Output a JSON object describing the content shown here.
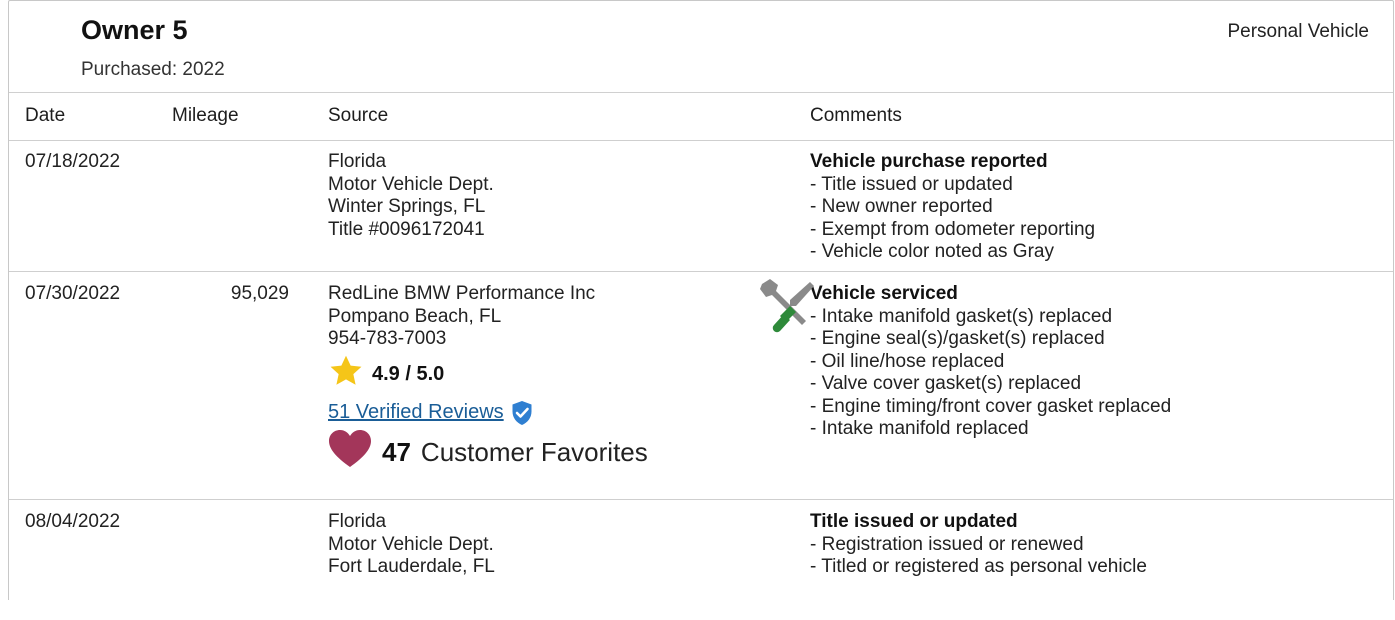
{
  "owner": {
    "title": "Owner 5",
    "purchased": "Purchased: 2022",
    "usage": "Personal Vehicle"
  },
  "table": {
    "headers": {
      "date": "Date",
      "mileage": "Mileage",
      "source": "Source",
      "comments": "Comments"
    },
    "rows": [
      {
        "date": "07/18/2022",
        "mileage": "",
        "source": [
          "Florida",
          "Motor Vehicle Dept.",
          "Winter Springs, FL",
          "Title #0096172041"
        ],
        "comment_head": "Vehicle purchase reported",
        "comments": [
          "- Title issued or updated",
          "- New owner reported",
          "- Exempt from odometer reporting",
          "- Vehicle color noted as Gray"
        ]
      },
      {
        "date": "07/30/2022",
        "mileage": "95,029",
        "source": [
          "RedLine BMW Performance Inc",
          "Pompano Beach, FL",
          "954-783-7003"
        ],
        "rating": "4.9 / 5.0",
        "reviews_link": "51 Verified Reviews",
        "favorites_count": "47",
        "favorites_label": "Customer Favorites",
        "comment_head": "Vehicle serviced",
        "comments": [
          "- Intake manifold gasket(s) replaced",
          "- Engine seal(s)/gasket(s) replaced",
          "- Oil line/hose replaced",
          "- Valve cover gasket(s) replaced",
          "- Engine timing/front cover gasket replaced",
          "- Intake manifold replaced"
        ]
      },
      {
        "date": "08/04/2022",
        "mileage": "",
        "source": [
          "Florida",
          "Motor Vehicle Dept.",
          "Fort Lauderdale, FL"
        ],
        "comment_head": "Title issued or updated",
        "comments": [
          "- Registration issued or renewed",
          "- Titled or registered as personal vehicle"
        ]
      }
    ]
  },
  "icons": {
    "star": "star-icon",
    "verified": "verified-shield-icon",
    "heart": "heart-icon",
    "service": "wrench-screwdriver-icon"
  },
  "colors": {
    "star": "#f5c518",
    "heart": "#a3365a",
    "verified": "#2f7fd1",
    "link": "#1a5d97",
    "wrench": "#8a8a8a",
    "screwdriver": "#2e8a3a"
  }
}
